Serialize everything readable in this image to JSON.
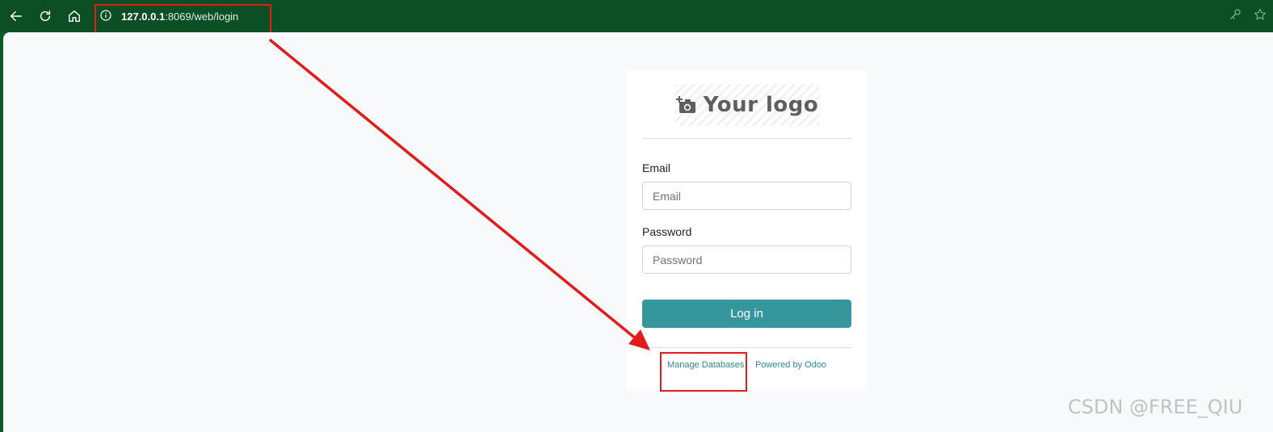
{
  "browser": {
    "url_host": "127.0.0.1",
    "url_rest": ":8069/web/login",
    "icons": [
      "back-icon",
      "reload-icon",
      "home-icon",
      "info-icon",
      "key-icon",
      "star-icon"
    ]
  },
  "login": {
    "logo_text": "Your logo",
    "logo_icon": "camera-plus-icon",
    "email_label": "Email",
    "email_placeholder": "Email",
    "password_label": "Password",
    "password_placeholder": "Password",
    "login_button": "Log in",
    "manage_databases": "Manage Databases",
    "powered_by": "Powered by Odoo"
  },
  "watermark": "CSDN @FREE_QIU",
  "colors": {
    "browser_bar": "#0c4f25",
    "primary_button": "#35979c",
    "link": "#2e8a8f",
    "annotation": "#e31b1b"
  }
}
